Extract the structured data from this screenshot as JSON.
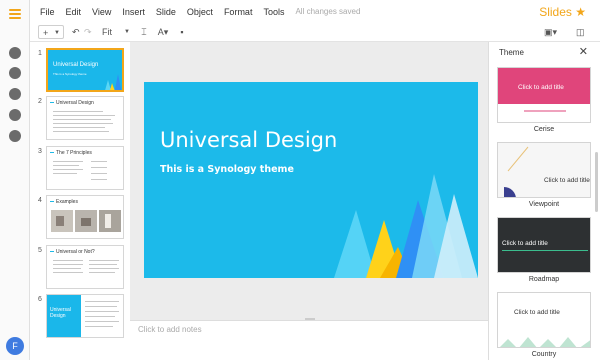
{
  "app": {
    "name": "Slides"
  },
  "menu": [
    "File",
    "Edit",
    "View",
    "Insert",
    "Slide",
    "Object",
    "Format",
    "Tools"
  ],
  "save_status": "All changes saved",
  "toolbar": {
    "add": "+",
    "zoom": "Fit"
  },
  "user": {
    "initial": "F"
  },
  "slides": [
    {
      "num": "1",
      "title": "Universal Design",
      "subtitle": "This is a Synology theme"
    },
    {
      "num": "2",
      "title": "Universal Design"
    },
    {
      "num": "3",
      "title": "The 7 Principles"
    },
    {
      "num": "4",
      "title": "Examples"
    },
    {
      "num": "5",
      "title": "Universal or Not?"
    },
    {
      "num": "6",
      "title": "Universal Design"
    }
  ],
  "current_slide": {
    "title": "Universal Design",
    "subtitle": "This is a Synology theme"
  },
  "notes_placeholder": "Click to add notes",
  "theme_panel": {
    "title": "Theme",
    "themes": [
      {
        "name": "Cerise",
        "placeholder": "Click to add title",
        "color": "#e0457b"
      },
      {
        "name": "Viewpoint",
        "placeholder": "Click to add title",
        "color": "#f5f5f5"
      },
      {
        "name": "Roadmap",
        "placeholder": "Click to add title",
        "color": "#2d3032"
      },
      {
        "name": "Country",
        "placeholder": "Click to add title",
        "color": "#ffffff"
      }
    ]
  },
  "colors": {
    "accent": "#f2a61a",
    "slide_bg": "#1cbaea",
    "avatar": "#3f7be0"
  }
}
